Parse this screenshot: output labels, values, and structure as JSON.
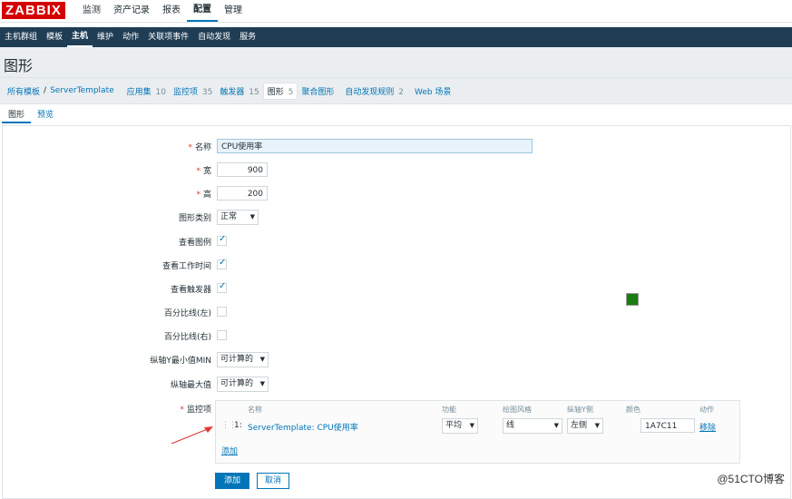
{
  "brand": "ZABBIX",
  "top_menu": [
    "监测",
    "资产记录",
    "报表",
    "配置",
    "管理"
  ],
  "sub_menu": [
    "主机群组",
    "模板",
    "主机",
    "维护",
    "动作",
    "关联项事件",
    "自动发现",
    "服务"
  ],
  "page_title": "图形",
  "breadcrumbs": {
    "all_templates": "所有模板",
    "separator": "/",
    "template": "ServerTemplate",
    "apps": {
      "label": "应用集",
      "count": "10"
    },
    "items": {
      "label": "监控项",
      "count": "35"
    },
    "triggers": {
      "label": "触发器",
      "count": "15"
    },
    "graphs": {
      "label": "图形",
      "count": "5"
    },
    "screens": "聚合图形",
    "discovery": {
      "label": "自动发现规则",
      "count": "2"
    },
    "web": "Web 场景"
  },
  "tabs": [
    "图形",
    "预览"
  ],
  "form": {
    "name": {
      "label": "名称",
      "value": "CPU使用率"
    },
    "width": {
      "label": "宽",
      "value": "900"
    },
    "height": {
      "label": "高",
      "value": "200"
    },
    "graph_type": {
      "label": "图形类别",
      "value": "正常"
    },
    "show_legend": {
      "label": "查看图例",
      "checked": true
    },
    "show_work_period": {
      "label": "查看工作时间",
      "checked": true
    },
    "show_triggers": {
      "label": "查看触发器",
      "checked": true
    },
    "percentile_left": {
      "label": "百分比线(左)",
      "checked": false
    },
    "percentile_right": {
      "label": "百分比线(右)",
      "checked": false
    },
    "ymin": {
      "label": "纵轴Y最小值MIN",
      "value": "可计算的"
    },
    "ymax": {
      "label": "纵轴最大值",
      "value": "可计算的"
    },
    "items_label": "监控项"
  },
  "items_table": {
    "headers": {
      "name": "名称",
      "function": "功能",
      "draw_style": "绘图风格",
      "y_axis": "纵轴Y侧",
      "color": "颜色",
      "action": "动作"
    },
    "rows": [
      {
        "index": "1:",
        "name": "ServerTemplate: CPU使用率",
        "function": "平均",
        "draw_style": "线",
        "y_axis": "左侧",
        "color": "1A7C11",
        "color_hex": "#1A7C11",
        "action": "移除"
      }
    ],
    "add_link": "添加"
  },
  "buttons": {
    "add": "添加",
    "cancel": "取消"
  },
  "watermark": "@51CTO博客"
}
